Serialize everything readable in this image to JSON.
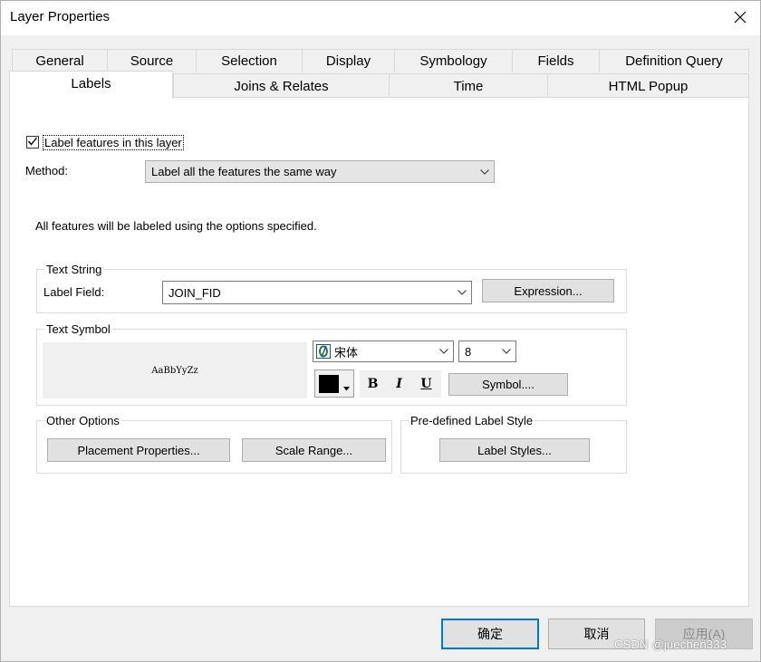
{
  "window": {
    "title": "Layer Properties"
  },
  "tabs": {
    "row1": [
      {
        "label": "General"
      },
      {
        "label": "Source"
      },
      {
        "label": "Selection"
      },
      {
        "label": "Display"
      },
      {
        "label": "Symbology"
      },
      {
        "label": "Fields"
      },
      {
        "label": "Definition Query"
      }
    ],
    "row2": [
      {
        "label": "Labels",
        "active": true
      },
      {
        "label": "Joins & Relates"
      },
      {
        "label": "Time"
      },
      {
        "label": "HTML Popup"
      }
    ]
  },
  "labels_page": {
    "label_features_checkbox": {
      "label": "Label features in this layer",
      "checked": true
    },
    "method": {
      "label": "Method:",
      "value": "Label all the features the same way"
    },
    "description": "All features will be labeled using the options specified.",
    "text_string": {
      "group_title": "Text String",
      "label_field_label": "Label Field:",
      "label_field_value": "JOIN_FID",
      "expression_button": "Expression..."
    },
    "text_symbol": {
      "group_title": "Text Symbol",
      "preview_text": "AaBbYyZz",
      "font_icon": "opentype-font-icon",
      "font_name": "宋体",
      "font_size": "8",
      "color": "#000000",
      "bold_label": "B",
      "italic_label": "I",
      "underline_label": "U",
      "symbol_button": "Symbol...."
    },
    "other_options": {
      "group_title": "Other Options",
      "placement_button": "Placement Properties...",
      "scale_range_button": "Scale Range..."
    },
    "predefined_style": {
      "group_title": "Pre-defined Label Style",
      "label_styles_button": "Label Styles..."
    }
  },
  "footer": {
    "ok_button": "确定",
    "cancel_button": "取消",
    "apply_button": "应用(A)"
  },
  "watermark": "CSDN @juechen333"
}
